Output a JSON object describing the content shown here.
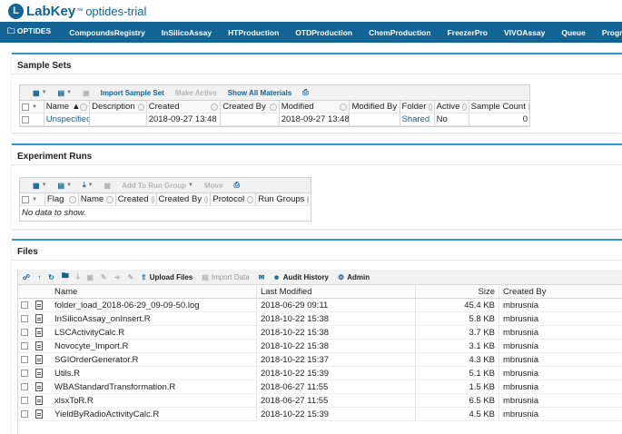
{
  "header": {
    "logo": "LabKey",
    "logo_tm": "™",
    "project": "optides-trial"
  },
  "nav": {
    "items": [
      "OPTIDES",
      "CompoundsRegistry",
      "InSilicoAssay",
      "HTProduction",
      "OTDProduction",
      "ChemProduction",
      "FreezerPro",
      "VIVOAssay",
      "Queue",
      "Programs"
    ]
  },
  "sample_sets": {
    "title": "Sample Sets",
    "toolbar": {
      "import": "Import Sample Set",
      "make_active": "Make Active",
      "show_all": "Show All Materials"
    },
    "columns": [
      "Name",
      "Description",
      "Created",
      "Created By",
      "Modified",
      "Modified By",
      "Folder",
      "Active",
      "Sample Count"
    ],
    "rows": [
      {
        "name": "Unspecified",
        "description": "",
        "created": "2018-09-27 13:48",
        "created_by": "",
        "modified": "2018-09-27 13:48",
        "modified_by": "",
        "folder": "Shared",
        "active": "No",
        "sample_count": "0"
      }
    ]
  },
  "experiment_runs": {
    "title": "Experiment Runs",
    "toolbar": {
      "add_group": "Add To Run Group",
      "move": "Move"
    },
    "columns": [
      "Flag",
      "Name",
      "Created",
      "Created By",
      "Protocol",
      "Run Groups"
    ],
    "empty": "No data to show."
  },
  "files": {
    "title": "Files",
    "toolbar": {
      "upload": "Upload Files",
      "import": "Import Data",
      "audit": "Audit History",
      "admin": "Admin"
    },
    "columns": {
      "name": "Name",
      "modified": "Last Modified",
      "size": "Size",
      "created_by": "Created By"
    },
    "rows": [
      {
        "name": "folder_load_2018-06-29_09-09-50.log",
        "modified": "2018-06-29 09:11",
        "size": "45.4 KB",
        "by": "mbrusnia"
      },
      {
        "name": "InSilicoAssay_onInsert.R",
        "modified": "2018-10-22 15:38",
        "size": "5.8 KB",
        "by": "mbrusnia"
      },
      {
        "name": "LSCActivityCalc.R",
        "modified": "2018-10-22 15:38",
        "size": "3.7 KB",
        "by": "mbrusnia"
      },
      {
        "name": "Novocyte_Import.R",
        "modified": "2018-10-22 15:38",
        "size": "3.1 KB",
        "by": "mbrusnia"
      },
      {
        "name": "SGIOrderGenerator.R",
        "modified": "2018-10-22 15:37",
        "size": "4.3 KB",
        "by": "mbrusnia"
      },
      {
        "name": "Utils.R",
        "modified": "2018-10-22 15:39",
        "size": "5.1 KB",
        "by": "mbrusnia"
      },
      {
        "name": "WBAStandardTransformation.R",
        "modified": "2018-06-27 11:55",
        "size": "1.5 KB",
        "by": "mbrusnia"
      },
      {
        "name": "xlsxToR.R",
        "modified": "2018-06-27 11:55",
        "size": "6.5 KB",
        "by": "mbrusnia"
      },
      {
        "name": "YieldByRadioActivityCalc.R",
        "modified": "2018-10-22 15:39",
        "size": "4.5 KB",
        "by": "mbrusnia"
      }
    ]
  }
}
